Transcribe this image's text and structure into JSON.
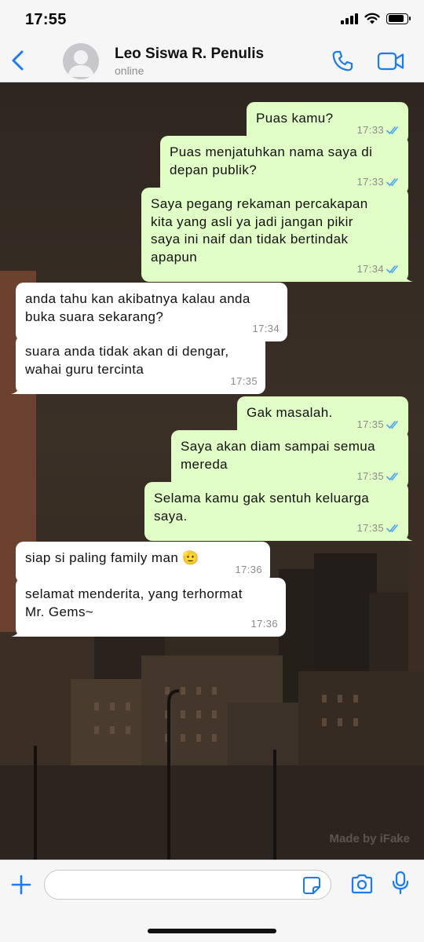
{
  "status_bar": {
    "time": "17:55"
  },
  "header": {
    "contact_name": "Leo Siswa R. Penulis",
    "contact_status": "online"
  },
  "messages": [
    {
      "dir": "out",
      "text": "Puas kamu?",
      "time": "17:33"
    },
    {
      "dir": "out",
      "text": "Puas menjatuhkan nama saya di\ndepan publik?",
      "time": "17:33"
    },
    {
      "dir": "out",
      "text": "Saya pegang rekaman percakapan\nkita yang asli ya jadi jangan pikir\nsaya ini naif dan tidak bertindak\napapun",
      "time": "17:34"
    },
    {
      "dir": "in",
      "text": "anda tahu kan akibatnya kalau anda\nbuka suara sekarang?",
      "time": "17:34"
    },
    {
      "dir": "in",
      "text": "suara anda tidak akan di dengar,\nwahai guru tercinta",
      "time": "17:35"
    },
    {
      "dir": "out",
      "text": "Gak masalah.",
      "time": "17:35"
    },
    {
      "dir": "out",
      "text": "Saya akan diam sampai semua\nmereda",
      "time": "17:35"
    },
    {
      "dir": "out",
      "text": "Selama kamu gak sentuh keluarga\nsaya.",
      "time": "17:35"
    },
    {
      "dir": "in",
      "text": "siap si paling family man 🫡",
      "time": "17:36"
    },
    {
      "dir": "in",
      "text": "selamat menderita, yang terhormat\nMr. Gems~",
      "time": "17:36"
    }
  ],
  "watermark": "Made by iFake",
  "input": {
    "value": "",
    "placeholder": ""
  },
  "colors": {
    "accent": "#1a7cf5",
    "outgoing_bubble": "#e1fec6",
    "incoming_bubble": "#ffffff",
    "read_ticks": "#4aa6f0"
  },
  "icons": {
    "back": "chevron-left-icon",
    "call": "phone-icon",
    "video": "video-camera-icon",
    "plus": "plus-icon",
    "sticker": "sticker-icon",
    "camera": "camera-icon",
    "mic": "microphone-icon"
  }
}
